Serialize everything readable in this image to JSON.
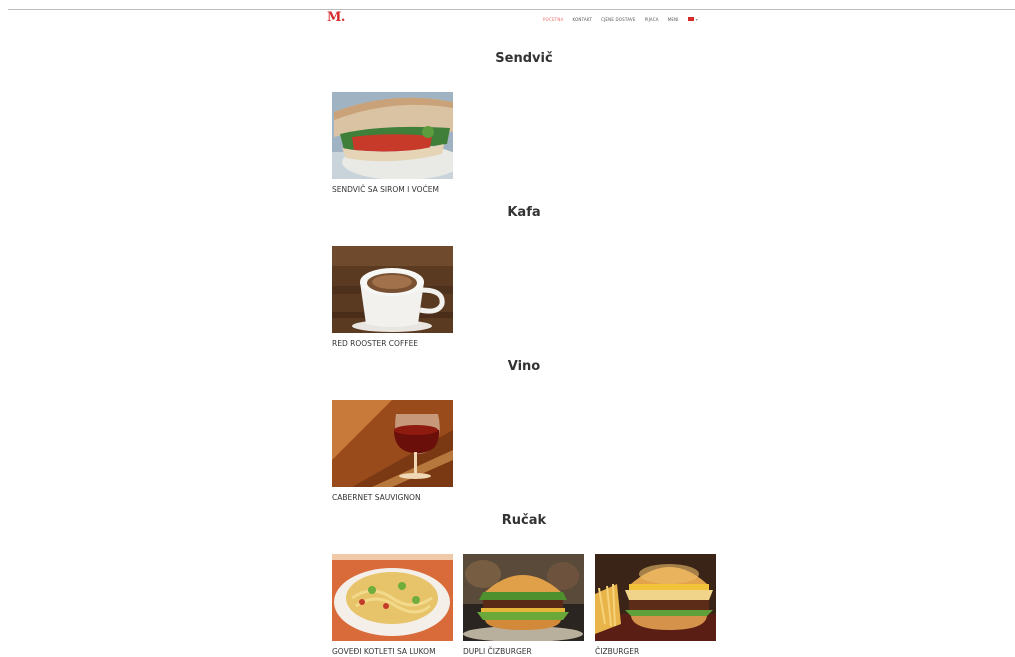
{
  "header": {
    "logo": "M.",
    "nav": [
      {
        "label": "Početna",
        "active": true
      },
      {
        "label": "Kontakt",
        "active": false
      },
      {
        "label": "Cjene dostave",
        "active": false
      },
      {
        "label": "Pijaca",
        "active": false
      },
      {
        "label": "Meni",
        "active": false
      }
    ],
    "language_flag": "flag-icon",
    "accent_color": "#d62b2b"
  },
  "sections": [
    {
      "title": "Sendvič",
      "items": [
        {
          "name": "SENDVIČ SA SIROM I VOĆEM",
          "image": "sandwich-photo"
        }
      ]
    },
    {
      "title": "Kafa",
      "items": [
        {
          "name": "RED ROOSTER COFFEE",
          "image": "coffee-cup-photo"
        }
      ]
    },
    {
      "title": "Vino",
      "items": [
        {
          "name": "CABERNET SAUVIGNON",
          "image": "wine-glass-photo"
        }
      ]
    },
    {
      "title": "Ručak",
      "items": [
        {
          "name": "GOVEĐI KOTLETI SA LUKOM",
          "image": "pasta-bowl-photo"
        },
        {
          "name": "DUPLI ČIZBURGER",
          "image": "double-burger-photo"
        },
        {
          "name": "ČIZBURGER",
          "image": "burger-fries-photo"
        }
      ]
    }
  ]
}
